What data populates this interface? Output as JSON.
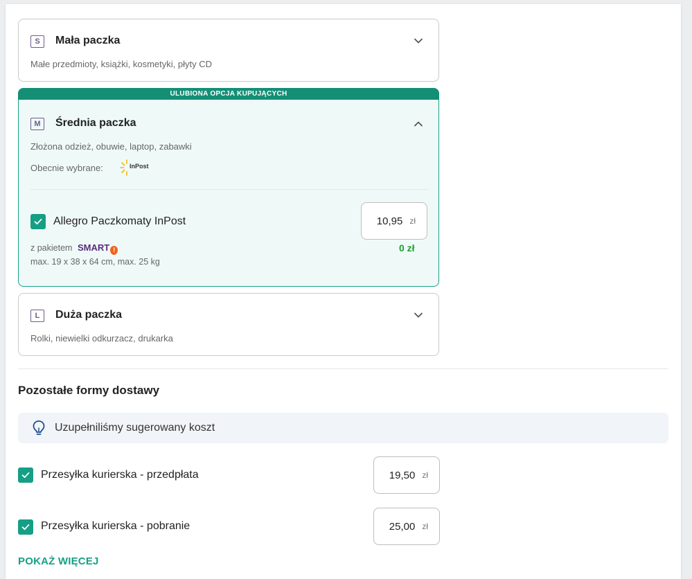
{
  "parcels": [
    {
      "size": "S",
      "title": "Mała paczka",
      "desc": "Małe przedmioty, książki, kosmetyki, płyty CD"
    },
    {
      "size": "M",
      "title": "Średnia paczka",
      "desc": "Złożona odzież, obuwie, laptop, zabawki"
    },
    {
      "size": "L",
      "title": "Duża paczka",
      "desc": "Rolki, niewielki odkurzacz, drukarka"
    }
  ],
  "favorite_label": "ULUBIONA OPCJA KUPUJĄCYCH",
  "selected": {
    "label": "Obecnie wybrane:",
    "carrier_logo_text": "InPost",
    "option_label": "Allegro Paczkomaty InPost",
    "price": "10,95",
    "currency": "zł",
    "smart_prefix": "z pakietem",
    "smart_label": "SMART",
    "smart_price": "0 zł",
    "dimensions": "max. 19 x 38 x 64 cm, max. 25 kg"
  },
  "other": {
    "heading": "Pozostałe formy dostawy",
    "info": "Uzupełniliśmy sugerowany koszt",
    "options": [
      {
        "label": "Przesyłka kurierska - przedpłata",
        "price": "19,50",
        "currency": "zł"
      },
      {
        "label": "Przesyłka kurierska - pobranie",
        "price": "25,00",
        "currency": "zł"
      }
    ],
    "show_more": "POKAŻ WIĘCEJ"
  },
  "colors": {
    "accent": "#16a085",
    "accent_dark": "#148f76",
    "size_badge": "#6e5a8c",
    "smart": "#5a2d7a",
    "smart_price": "#1e9e2e"
  }
}
